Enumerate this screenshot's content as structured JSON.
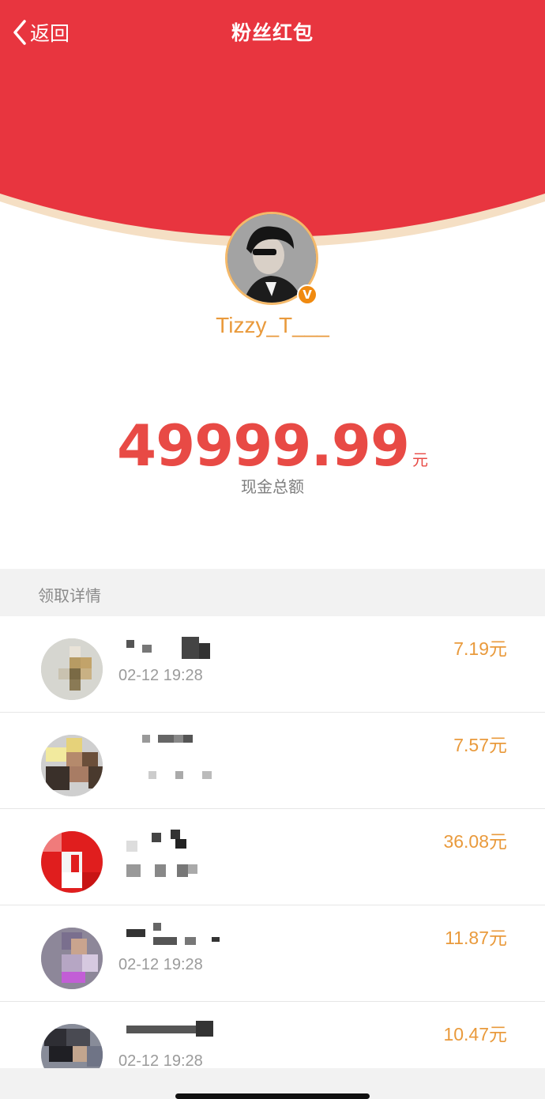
{
  "nav": {
    "back_label": "返回",
    "title": "粉丝红包"
  },
  "profile": {
    "username": "Tizzy_T___",
    "verified_badge": "V"
  },
  "amount": {
    "value": "49999.99",
    "unit": "元",
    "label": "现金总额"
  },
  "section": {
    "title": "领取详情"
  },
  "records": [
    {
      "time": "02-12 19:28",
      "amount": "7.19元"
    },
    {
      "time": "",
      "amount": "7.57元"
    },
    {
      "time": "",
      "amount": "36.08元"
    },
    {
      "time": "02-12 19:28",
      "amount": "11.87元"
    },
    {
      "time": "02-12 19:28",
      "amount": "10.47元"
    }
  ],
  "colors": {
    "header_red": "#e8353f",
    "amount_red": "#e84a45",
    "accent_orange": "#e99a3c"
  },
  "icons": {
    "back": "chevron-left-icon",
    "verified": "verified-badge-icon"
  }
}
